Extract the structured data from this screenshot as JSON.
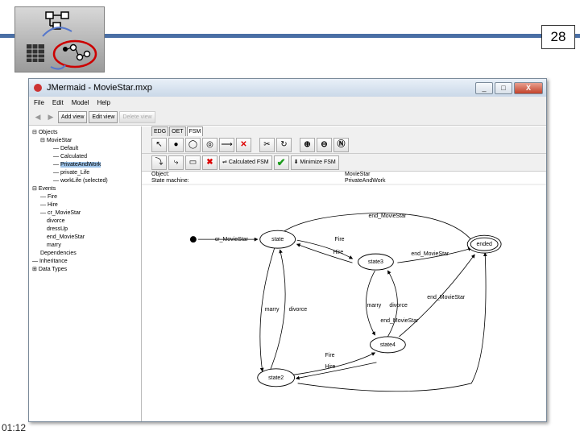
{
  "slide": {
    "page_number": "28",
    "footer_time": "01:12"
  },
  "window": {
    "title": "JMermaid - MovieStar.mxp",
    "buttons": {
      "minimize": "_",
      "maximize": "□",
      "close": "X"
    }
  },
  "menu": [
    "File",
    "Edit",
    "Model",
    "Help"
  ],
  "toolbar": {
    "back": "◀",
    "forward": "▶",
    "add_view": "Add view",
    "edit_view": "Edit view",
    "delete_view": "Delete view"
  },
  "tree": {
    "objects": "Objects",
    "moviestar": "MovieStar",
    "fsms": [
      "Default",
      "Calculated",
      "PrivateAndWork",
      "private_Life",
      "workLife (selected)"
    ],
    "events": "Events",
    "event_list": [
      "Fire",
      "Hire",
      "cr_MovieStar",
      "divorce",
      "dressUp",
      "end_MovieStar",
      "marry"
    ],
    "dependencies": "Dependencies",
    "inheritance": "Inheritance",
    "data_types": "Data Types"
  },
  "tabs": [
    "EDG",
    "OET",
    "FSM"
  ],
  "tools": {
    "calculated_fsm": "Calculated FSM",
    "minimize_fsm": "Minimize FSM"
  },
  "info": {
    "object_label": "Object:",
    "object_value": "MovieStar",
    "sm_label": "State machine:",
    "sm_value": "PrivateAndWork"
  },
  "fsm": {
    "states": [
      "state",
      "state3",
      "state4",
      "state2",
      "ended"
    ],
    "transitions": [
      "cr_MovieStar",
      "end_MovieStar",
      "Fire",
      "Hire",
      "end_MovieStar",
      "marry",
      "divorce",
      "marry",
      "divorce",
      "end_MovieStar",
      "end_MovieStar",
      "Fire",
      "Hire"
    ]
  }
}
